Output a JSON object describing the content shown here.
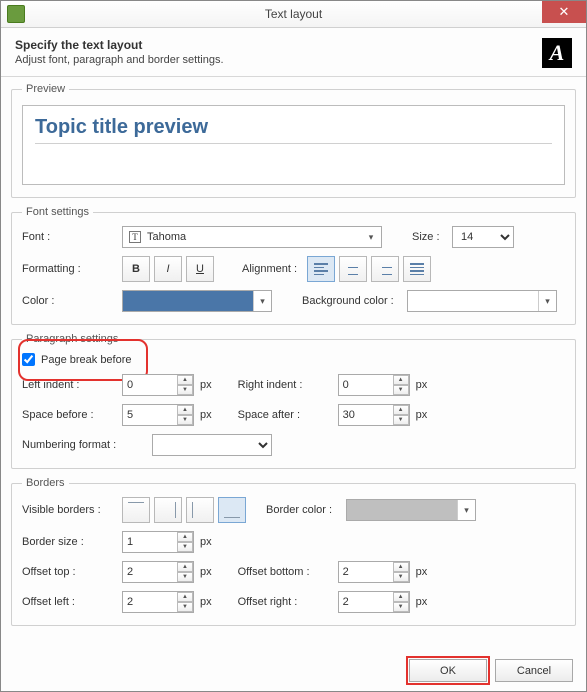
{
  "window": {
    "title": "Text layout"
  },
  "header": {
    "title": "Specify the text layout",
    "subtitle": "Adjust font, paragraph and border settings."
  },
  "preview": {
    "legend": "Preview",
    "text": "Topic title preview"
  },
  "font": {
    "legend": "Font settings",
    "font_label": "Font :",
    "font_value": "Tahoma",
    "size_label": "Size :",
    "size_value": "14",
    "formatting_label": "Formatting :",
    "alignment_label": "Alignment :",
    "color_label": "Color :",
    "color_value": "#4a76a8",
    "bgcolor_label": "Background color :",
    "bgcolor_value": "#ffffff"
  },
  "para": {
    "legend": "Paragraph settings",
    "pagebreak_label": "Page break before",
    "pagebreak_checked": true,
    "leftindent_label": "Left indent :",
    "leftindent_value": "0",
    "rightindent_label": "Right indent :",
    "rightindent_value": "0",
    "spacebefore_label": "Space before :",
    "spacebefore_value": "5",
    "spaceafter_label": "Space after :",
    "spaceafter_value": "30",
    "numfmt_label": "Numbering format :",
    "px": "px"
  },
  "borders": {
    "legend": "Borders",
    "visible_label": "Visible borders :",
    "bordercolor_label": "Border color :",
    "bordercolor_value": "#bfbfbf",
    "bordersize_label": "Border size :",
    "bordersize_value": "1",
    "offtop_label": "Offset top :",
    "offtop_value": "2",
    "offbot_label": "Offset bottom :",
    "offbot_value": "2",
    "offleft_label": "Offset left :",
    "offleft_value": "2",
    "offright_label": "Offset right :",
    "offright_value": "2",
    "px": "px"
  },
  "buttons": {
    "ok": "OK",
    "cancel": "Cancel"
  }
}
